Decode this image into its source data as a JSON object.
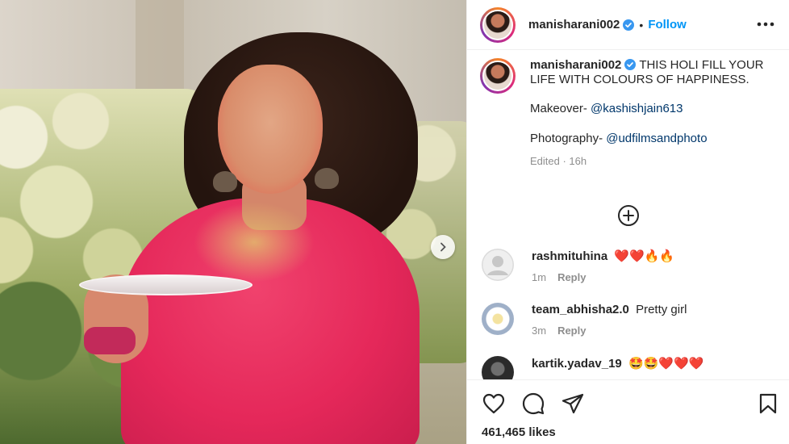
{
  "post": {
    "username": "manisharani002",
    "follow_label": "Follow",
    "separator": "•",
    "caption_lines": [
      "THIS HOLI FILL YOUR LIFE WITH COLOURS OF HAPPINESS."
    ],
    "makeover_label": "Makeover-",
    "makeover_mention": "@kashishjain613",
    "photography_label": "Photography-",
    "photography_mention": "@udfilmsandphoto",
    "edited_meta": "Edited · 16h"
  },
  "comments": [
    {
      "user": "rashmituhina",
      "text": "❤️❤️🔥🔥",
      "time": "1m",
      "reply": "Reply"
    },
    {
      "user": "team_abhisha2.0",
      "text": "Pretty girl",
      "time": "3m",
      "reply": "Reply"
    },
    {
      "user": "kartik.yadav_19",
      "text": "🤩🤩❤️❤️❤️"
    }
  ],
  "footer": {
    "likes": "461,465 likes"
  },
  "colors": {
    "follow": "#0095f6",
    "mention": "#00376b",
    "verified": "#3897f0",
    "muted": "#8e8e8e",
    "heart": "#e0245e"
  },
  "icons": {
    "carousel_next": "chevron-right-icon",
    "more": "more-horizontal-icon",
    "load_more": "plus-circle-icon",
    "like": "heart-outline-icon",
    "comment": "comment-icon",
    "share": "paper-plane-icon",
    "save": "bookmark-icon"
  }
}
